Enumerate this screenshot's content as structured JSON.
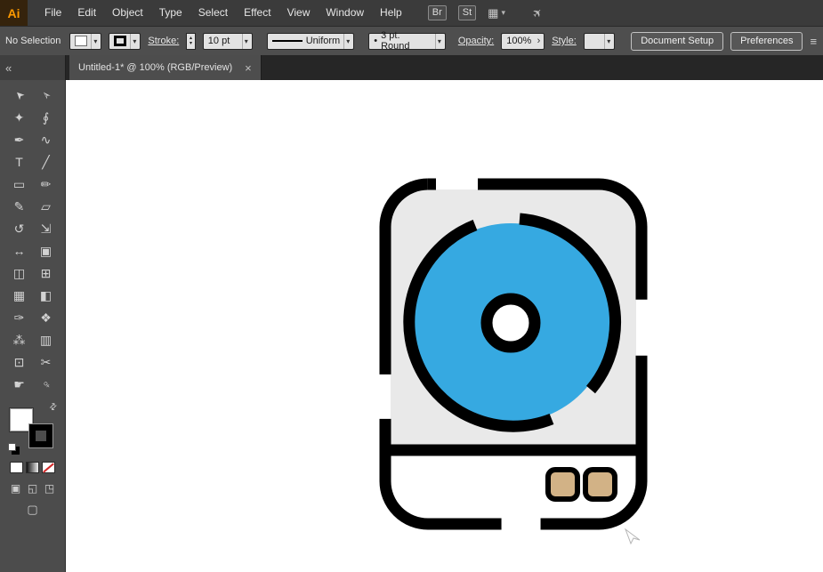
{
  "menubar": {
    "logo": "Ai",
    "items": [
      "File",
      "Edit",
      "Object",
      "Type",
      "Select",
      "Effect",
      "View",
      "Window",
      "Help"
    ],
    "bridge": "Br",
    "stock": "St",
    "icons": {
      "workspace": "▦",
      "chevron": "▾",
      "gpu": "✈"
    }
  },
  "controlbar": {
    "no_selection": "No Selection",
    "stroke_label": "Stroke:",
    "stroke_value": "10 pt",
    "profile_value": "Uniform",
    "brush_dot": "•",
    "brush_value": "3 pt. Round",
    "opacity_label": "Opacity:",
    "opacity_value": "100%",
    "style_label": "Style:",
    "document_setup": "Document Setup",
    "preferences": "Preferences"
  },
  "tabbar": {
    "title": "Untitled-1* @ 100% (RGB/Preview)",
    "close": "×"
  },
  "toolbar": {
    "collapse": "«",
    "swap_icon": "⇄",
    "tools": [
      {
        "name": "selection-tool",
        "glyph": "➤"
      },
      {
        "name": "direct-selection-tool",
        "glyph": "➢"
      },
      {
        "name": "magic-wand-tool",
        "glyph": "✦"
      },
      {
        "name": "lasso-tool",
        "glyph": "∮"
      },
      {
        "name": "pen-tool",
        "glyph": "✒"
      },
      {
        "name": "curvature-tool",
        "glyph": "∿"
      },
      {
        "name": "type-tool",
        "glyph": "T"
      },
      {
        "name": "line-segment-tool",
        "glyph": "╱"
      },
      {
        "name": "rectangle-tool",
        "glyph": "▭"
      },
      {
        "name": "paintbrush-tool",
        "glyph": "✏"
      },
      {
        "name": "pencil-tool",
        "glyph": "✎"
      },
      {
        "name": "eraser-tool",
        "glyph": "▱"
      },
      {
        "name": "rotate-tool",
        "glyph": "↺"
      },
      {
        "name": "scale-tool",
        "glyph": "⇲"
      },
      {
        "name": "width-tool",
        "glyph": "↔"
      },
      {
        "name": "free-transform-tool",
        "glyph": "▣"
      },
      {
        "name": "shape-builder-tool",
        "glyph": "◫"
      },
      {
        "name": "perspective-grid-tool",
        "glyph": "⊞"
      },
      {
        "name": "mesh-tool",
        "glyph": "▦"
      },
      {
        "name": "gradient-tool",
        "glyph": "◧"
      },
      {
        "name": "eyedropper-tool",
        "glyph": "✑"
      },
      {
        "name": "blend-tool",
        "glyph": "❖"
      },
      {
        "name": "symbol-sprayer-tool",
        "glyph": "⁂"
      },
      {
        "name": "column-graph-tool",
        "glyph": "▥"
      },
      {
        "name": "artboard-tool",
        "glyph": "⊡"
      },
      {
        "name": "slice-tool",
        "glyph": "✂"
      },
      {
        "name": "hand-tool",
        "glyph": "☛"
      },
      {
        "name": "zoom-tool",
        "glyph": "♀"
      }
    ],
    "drawing_modes": [
      "▣",
      "◱",
      "◳"
    ],
    "screen_mode": "▢"
  },
  "ui": {
    "chevron": "▾",
    "up": "▴",
    "down": "▾",
    "submenu": "›",
    "panel_menu": "≡"
  },
  "artwork": {
    "body_fill": "#e9e9e9",
    "lower_fill": "#ffffff",
    "outline": "#000000",
    "circle_blue": "#36a9e1",
    "button_tan": "#d2b286"
  }
}
